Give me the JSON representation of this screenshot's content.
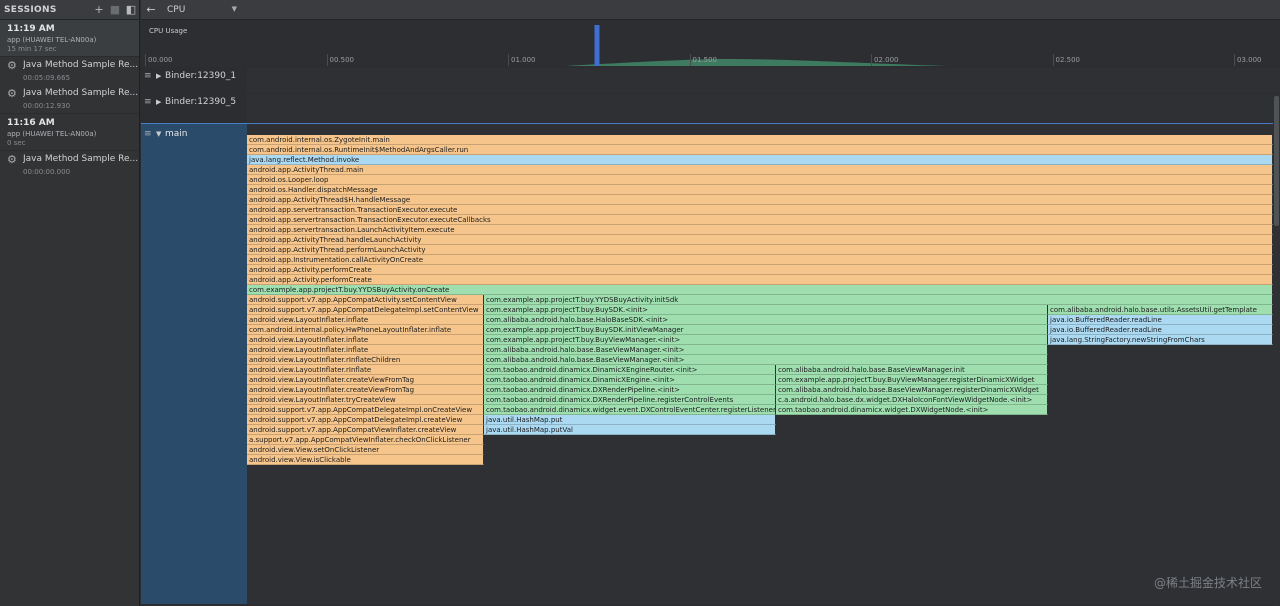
{
  "sessions": {
    "title": "SESSIONS",
    "buttons": {
      "add": "+",
      "stop": "■",
      "layout": "◧"
    },
    "list": [
      {
        "time": "11:19 AM",
        "app": "app (HUAWEI TEL-AN00a)",
        "duration": "15 min 17 sec",
        "recordings": [
          {
            "name": "Java Method Sample Re...",
            "duration": "00:05:09.665"
          },
          {
            "name": "Java Method Sample Re...",
            "duration": "00:00:12.930"
          }
        ]
      },
      {
        "time": "11:16 AM",
        "app": "app (HUAWEI TEL-AN00a)",
        "duration": "0 sec",
        "recordings": [
          {
            "name": "Java Method Sample Re...",
            "duration": "00:00:00.000"
          }
        ]
      }
    ]
  },
  "toolbar": {
    "back": "←",
    "profiler": "CPU",
    "dropdown_arrow": "▼"
  },
  "cpu": {
    "label": "CPU Usage",
    "ticks": [
      "00.000",
      "00.500",
      "01.000",
      "01.500",
      "02.000",
      "02.500",
      "03.000"
    ],
    "marker_time": 1.23,
    "marker_color": "#3e6fd1",
    "area_color": "#3d7a5f"
  },
  "threads": {
    "menu_icon": "≡",
    "collapsed_icon": "▶",
    "expanded_icon": "▼",
    "binder1": "Binder:12390_1",
    "binder2": "Binder:12390_5",
    "main": "main"
  },
  "colors": {
    "app": "#f6c58b",
    "platform": "#acd9f2",
    "vendor": "#9fdfaf"
  },
  "flame": [
    {
      "d": 0,
      "s": 0,
      "e": 1026,
      "c": "app",
      "t": "com.android.internal.os.ZygoteInit.main"
    },
    {
      "d": 1,
      "s": 0,
      "e": 1026,
      "c": "app",
      "t": "com.android.internal.os.RuntimeInit$MethodAndArgsCaller.run"
    },
    {
      "d": 2,
      "s": 0,
      "e": 1026,
      "c": "platform",
      "t": "java.lang.reflect.Method.invoke"
    },
    {
      "d": 3,
      "s": 0,
      "e": 1026,
      "c": "app",
      "t": "android.app.ActivityThread.main"
    },
    {
      "d": 4,
      "s": 0,
      "e": 1026,
      "c": "app",
      "t": "android.os.Looper.loop"
    },
    {
      "d": 5,
      "s": 0,
      "e": 1026,
      "c": "app",
      "t": "android.os.Handler.dispatchMessage"
    },
    {
      "d": 6,
      "s": 0,
      "e": 1026,
      "c": "app",
      "t": "android.app.ActivityThread$H.handleMessage"
    },
    {
      "d": 7,
      "s": 0,
      "e": 1026,
      "c": "app",
      "t": "android.app.servertransaction.TransactionExecutor.execute"
    },
    {
      "d": 8,
      "s": 0,
      "e": 1026,
      "c": "app",
      "t": "android.app.servertransaction.TransactionExecutor.executeCallbacks"
    },
    {
      "d": 9,
      "s": 0,
      "e": 1026,
      "c": "app",
      "t": "android.app.servertransaction.LaunchActivityItem.execute"
    },
    {
      "d": 10,
      "s": 0,
      "e": 1026,
      "c": "app",
      "t": "android.app.ActivityThread.handleLaunchActivity"
    },
    {
      "d": 11,
      "s": 0,
      "e": 1026,
      "c": "app",
      "t": "android.app.ActivityThread.performLaunchActivity"
    },
    {
      "d": 12,
      "s": 0,
      "e": 1026,
      "c": "app",
      "t": "android.app.Instrumentation.callActivityOnCreate"
    },
    {
      "d": 13,
      "s": 0,
      "e": 1026,
      "c": "app",
      "t": "android.app.Activity.performCreate"
    },
    {
      "d": 14,
      "s": 0,
      "e": 1026,
      "c": "app",
      "t": "android.app.Activity.performCreate"
    },
    {
      "d": 15,
      "s": 0,
      "e": 1026,
      "c": "vendor",
      "t": "com.example.app.projectT.buy.YYDSBuyActivity.onCreate"
    },
    {
      "d": 16,
      "s": 0,
      "e": 237,
      "c": "app",
      "t": "android.support.v7.app.AppCompatActivity.setContentView"
    },
    {
      "d": 17,
      "s": 0,
      "e": 237,
      "c": "app",
      "t": "android.support.v7.app.AppCompatDelegateImpl.setContentView"
    },
    {
      "d": 18,
      "s": 0,
      "e": 237,
      "c": "app",
      "t": "android.view.LayoutInflater.inflate"
    },
    {
      "d": 19,
      "s": 0,
      "e": 237,
      "c": "app",
      "t": "com.android.internal.policy.HwPhoneLayoutInflater.inflate"
    },
    {
      "d": 20,
      "s": 0,
      "e": 237,
      "c": "app",
      "t": "android.view.LayoutInflater.inflate"
    },
    {
      "d": 21,
      "s": 0,
      "e": 237,
      "c": "app",
      "t": "android.view.LayoutInflater.inflate"
    },
    {
      "d": 22,
      "s": 0,
      "e": 237,
      "c": "app",
      "t": "android.view.LayoutInflater.rInflateChildren"
    },
    {
      "d": 23,
      "s": 0,
      "e": 237,
      "c": "app",
      "t": "android.view.LayoutInflater.rInflate"
    },
    {
      "d": 24,
      "s": 0,
      "e": 237,
      "c": "app",
      "t": "android.view.LayoutInflater.createViewFromTag"
    },
    {
      "d": 25,
      "s": 0,
      "e": 237,
      "c": "app",
      "t": "android.view.LayoutInflater.createViewFromTag"
    },
    {
      "d": 26,
      "s": 0,
      "e": 237,
      "c": "app",
      "t": "android.view.LayoutInflater.tryCreateView"
    },
    {
      "d": 27,
      "s": 0,
      "e": 237,
      "c": "app",
      "t": "android.support.v7.app.AppCompatDelegateImpl.onCreateView"
    },
    {
      "d": 28,
      "s": 0,
      "e": 237,
      "c": "app",
      "t": "android.support.v7.app.AppCompatDelegateImpl.createView"
    },
    {
      "d": 29,
      "s": 0,
      "e": 237,
      "c": "app",
      "t": "android.support.v7.app.AppCompatViewInflater.createView"
    },
    {
      "d": 30,
      "s": 0,
      "e": 237,
      "c": "app",
      "t": "a.support.v7.app.AppCompatViewInflater.checkOnClickListener"
    },
    {
      "d": 31,
      "s": 0,
      "e": 237,
      "c": "app",
      "t": "android.view.View.setOnClickListener"
    },
    {
      "d": 32,
      "s": 0,
      "e": 237,
      "c": "app",
      "t": "android.view.View.isClickable"
    },
    {
      "d": 16,
      "s": 237,
      "e": 1026,
      "c": "vendor",
      "t": "com.example.app.projectT.buy.YYDSBuyActivity.initSdk"
    },
    {
      "d": 17,
      "s": 237,
      "e": 801,
      "c": "vendor",
      "t": "com.example.app.projectT.buy.BuySDK.<init>"
    },
    {
      "d": 18,
      "s": 237,
      "e": 801,
      "c": "vendor",
      "t": "com.alibaba.android.halo.base.HaloBaseSDK.<init>"
    },
    {
      "d": 19,
      "s": 237,
      "e": 801,
      "c": "vendor",
      "t": "com.example.app.projectT.buy.BuySDK.initViewManager"
    },
    {
      "d": 20,
      "s": 237,
      "e": 801,
      "c": "vendor",
      "t": "com.example.app.projectT.buy.BuyViewManager.<init>"
    },
    {
      "d": 21,
      "s": 237,
      "e": 801,
      "c": "vendor",
      "t": "com.alibaba.android.halo.base.BaseViewManager.<init>"
    },
    {
      "d": 22,
      "s": 237,
      "e": 801,
      "c": "vendor",
      "t": "com.alibaba.android.halo.base.BaseViewManager.<init>"
    },
    {
      "d": 23,
      "s": 237,
      "e": 529,
      "c": "vendor",
      "t": "com.taobao.android.dinamicx.DinamicXEngineRouter.<init>"
    },
    {
      "d": 24,
      "s": 237,
      "e": 529,
      "c": "vendor",
      "t": "com.taobao.android.dinamicx.DinamicXEngine.<init>"
    },
    {
      "d": 25,
      "s": 237,
      "e": 529,
      "c": "vendor",
      "t": "com.taobao.android.dinamicx.DXRenderPipeline.<init>"
    },
    {
      "d": 26,
      "s": 237,
      "e": 529,
      "c": "vendor",
      "t": "com.taobao.android.dinamicx.DXRenderPipeline.registerControlEvents"
    },
    {
      "d": 27,
      "s": 237,
      "e": 529,
      "c": "vendor",
      "t": "com.taobao.android.dinamicx.widget.event.DXControlEventCenter.registerListener"
    },
    {
      "d": 28,
      "s": 237,
      "e": 529,
      "c": "platform",
      "t": "java.util.HashMap.put"
    },
    {
      "d": 29,
      "s": 237,
      "e": 529,
      "c": "platform",
      "t": "java.util.HashMap.putVal"
    },
    {
      "d": 23,
      "s": 529,
      "e": 801,
      "c": "vendor",
      "t": "com.alibaba.android.halo.base.BaseViewManager.init"
    },
    {
      "d": 24,
      "s": 529,
      "e": 801,
      "c": "vendor",
      "t": "com.example.app.projectT.buy.BuyViewManager.registerDinamicXWidget"
    },
    {
      "d": 25,
      "s": 529,
      "e": 801,
      "c": "vendor",
      "t": "com.alibaba.android.halo.base.BaseViewManager.registerDinamicXWidget"
    },
    {
      "d": 26,
      "s": 529,
      "e": 801,
      "c": "vendor",
      "t": "c.a.android.halo.base.dx.widget.DXHaloIconFontViewWidgetNode.<init>"
    },
    {
      "d": 27,
      "s": 529,
      "e": 801,
      "c": "vendor",
      "t": "com.taobao.android.dinamicx.widget.DXWidgetNode.<init>"
    },
    {
      "d": 17,
      "s": 801,
      "e": 1026,
      "c": "vendor",
      "t": "com.alibaba.android.halo.base.utils.AssetsUtil.getTemplate"
    },
    {
      "d": 18,
      "s": 801,
      "e": 1026,
      "c": "platform",
      "t": "java.io.BufferedReader.readLine"
    },
    {
      "d": 19,
      "s": 801,
      "e": 1026,
      "c": "platform",
      "t": "java.io.BufferedReader.readLine"
    },
    {
      "d": 20,
      "s": 801,
      "e": 1026,
      "c": "platform",
      "t": "java.lang.StringFactory.newStringFromChars"
    }
  ],
  "watermark": "@稀土掘金技术社区"
}
